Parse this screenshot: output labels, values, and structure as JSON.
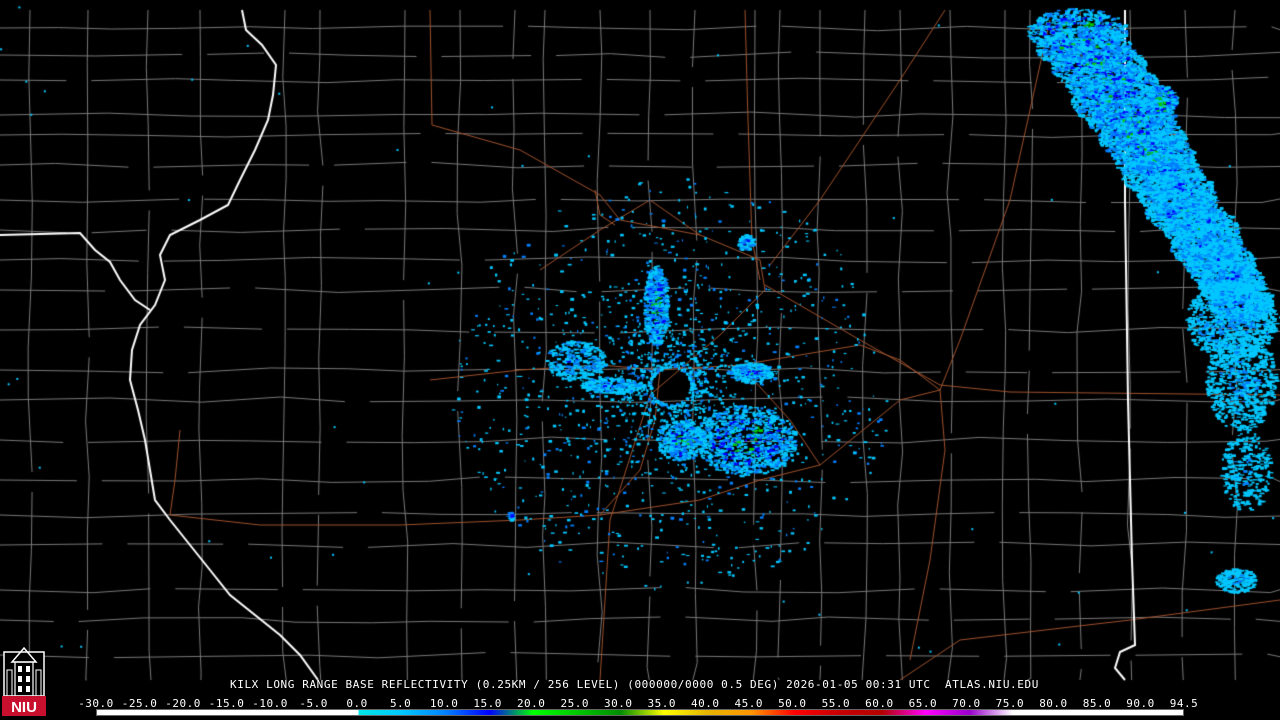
{
  "product": {
    "text": "KILX LONG RANGE BASE REFLECTIVITY (0.25KM / 256 LEVEL) (000000/0000 0.5 DEG) 2026-01-05 00:31 UTC  ATLAS.NIU.EDU"
  },
  "logo": {
    "text": "NIU",
    "icon": "university-tower-icon",
    "colors": {
      "background": "#c8102e",
      "tower": "#ffffff"
    }
  },
  "colorbar": {
    "labels": [
      "-30.0",
      "-25.0",
      "-20.0",
      "-15.0",
      "-10.0",
      "-5.0",
      "0.0",
      "5.0",
      "10.0",
      "15.0",
      "20.0",
      "25.0",
      "30.0",
      "35.0",
      "40.0",
      "45.0",
      "50.0",
      "55.0",
      "60.0",
      "65.0",
      "70.0",
      "75.0",
      "80.0",
      "85.0",
      "90.0",
      "94.5"
    ],
    "min": -30.0,
    "max": 94.5,
    "stops": [
      {
        "v": -30,
        "c": "#ffffff"
      },
      {
        "v": 0,
        "c": "#ffffff"
      },
      {
        "v": 0.01,
        "c": "#00e6e6"
      },
      {
        "v": 5,
        "c": "#00c8ff"
      },
      {
        "v": 10,
        "c": "#0080ff"
      },
      {
        "v": 15,
        "c": "#0000ff"
      },
      {
        "v": 20,
        "c": "#00ff00"
      },
      {
        "v": 25,
        "c": "#00c800"
      },
      {
        "v": 30,
        "c": "#008c00"
      },
      {
        "v": 35,
        "c": "#ffff00"
      },
      {
        "v": 40,
        "c": "#e6b400"
      },
      {
        "v": 45,
        "c": "#ff9600"
      },
      {
        "v": 50,
        "c": "#ff0000"
      },
      {
        "v": 55,
        "c": "#c80000"
      },
      {
        "v": 60,
        "c": "#b40000"
      },
      {
        "v": 65,
        "c": "#ff00ff"
      },
      {
        "v": 70,
        "c": "#9900cc"
      },
      {
        "v": 75,
        "c": "#ffffff"
      },
      {
        "v": 94.5,
        "c": "#ffffff"
      }
    ]
  },
  "map_colors": {
    "background": "#000000",
    "county_lines": "#7a7a7a",
    "state_lines": "#ffffff",
    "roads": "#a0522d",
    "echo_light": "#00c8ff",
    "echo_mid": "#0080ff",
    "echo_heavy": "#0000ff",
    "echo_core": "#00c800"
  }
}
